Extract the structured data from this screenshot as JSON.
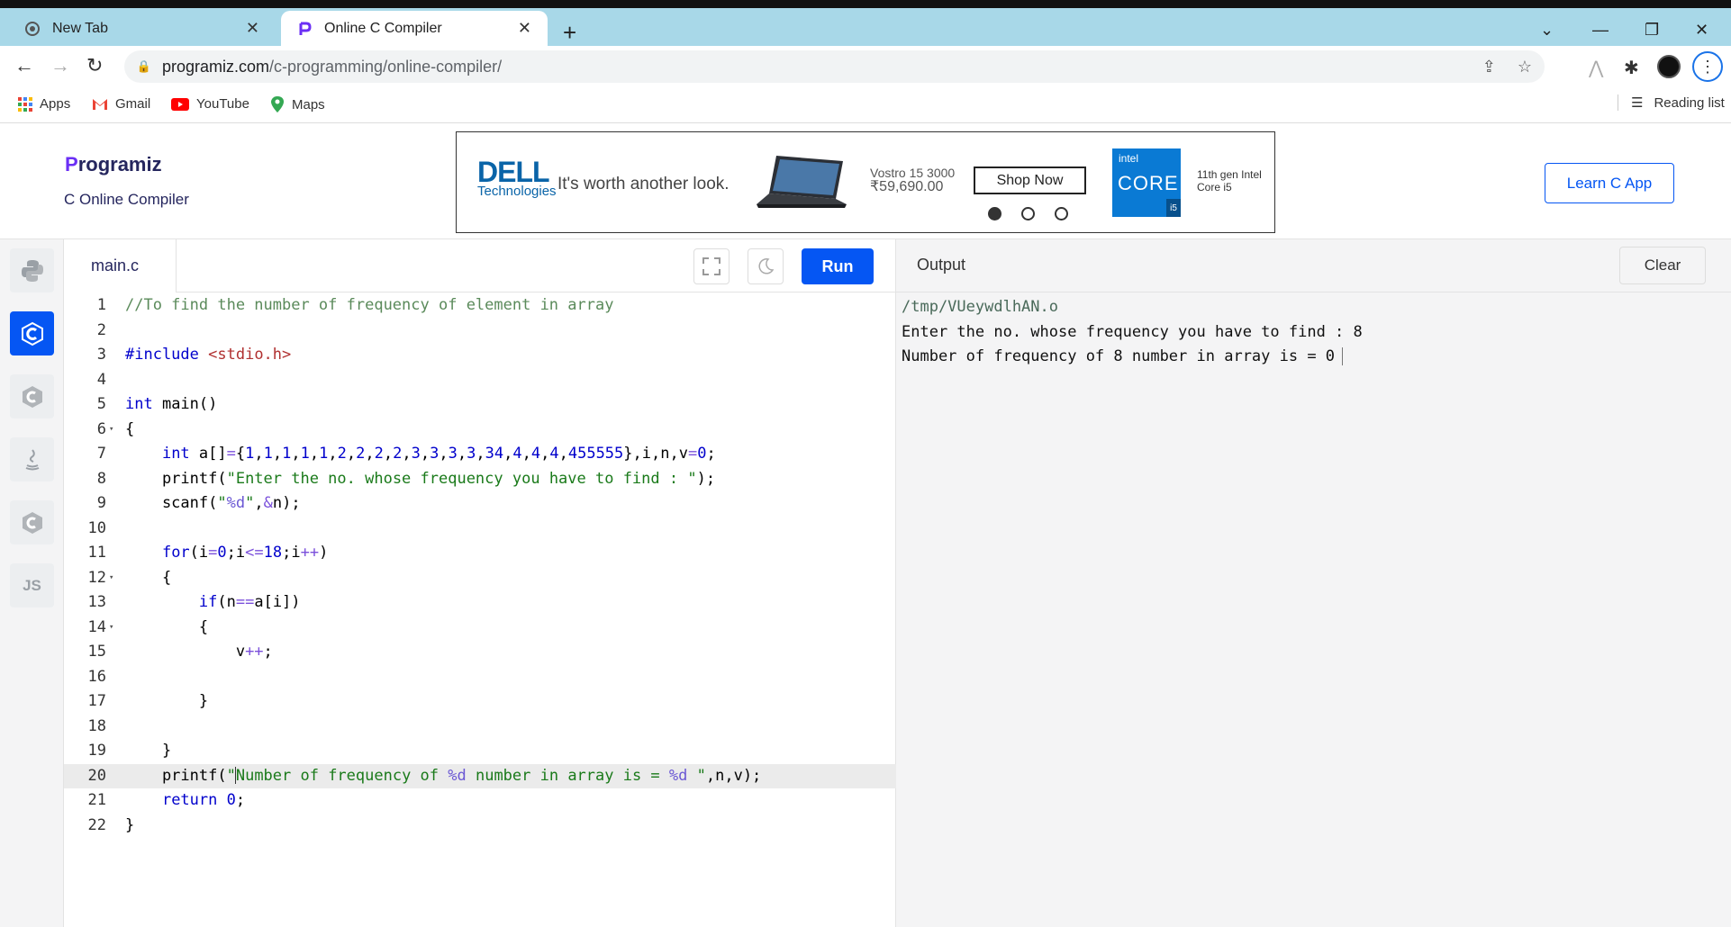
{
  "browser": {
    "tabs": [
      {
        "title": "New Tab",
        "active": false
      },
      {
        "title": "Online C Compiler",
        "active": true
      }
    ],
    "url_domain": "programiz.com",
    "url_path": "/c-programming/online-compiler/",
    "bookmarks": [
      "Apps",
      "Gmail",
      "YouTube",
      "Maps"
    ],
    "reading_list": "Reading list"
  },
  "site": {
    "logo_initial": "P",
    "logo_rest": "rogramiz",
    "subtitle": "C Online Compiler",
    "learn_button": "Learn C App"
  },
  "ad": {
    "brand": "DELL",
    "brand_sub": "Technologies",
    "tagline": "It's worth another look.",
    "model": "Vostro 15 3000",
    "price": "₹59,690.00",
    "cta": "Shop Now",
    "intel_top": "intel",
    "intel_core": "CORE",
    "intel_tier": "i5",
    "gen_line1": "11th gen Intel",
    "gen_line2": "Core i5"
  },
  "rail": {
    "items": [
      "python",
      "c",
      "cpp",
      "java",
      "csharp",
      "JS"
    ],
    "active": "c"
  },
  "editor": {
    "filename": "main.c",
    "run_label": "Run",
    "highlighted_line": 20,
    "code_lines": [
      "//To find the number of frequency of element in array",
      "",
      "#include <stdio.h>",
      "",
      "int main()",
      "{",
      "    int a[]={1,1,1,1,1,2,2,2,2,3,3,3,3,34,4,4,4,455555},i,n,v=0;",
      "    printf(\"Enter the no. whose frequency you have to find : \");",
      "    scanf(\"%d\",&n);",
      "",
      "    for(i=0;i<=18;i++)",
      "    {",
      "        if(n==a[i])",
      "        {",
      "            v++;",
      "",
      "        }",
      "",
      "    }",
      "    printf(\"Number of frequency of %d number in array is = %d \",n,v);",
      "    return 0;",
      "}"
    ]
  },
  "output": {
    "title": "Output",
    "clear_label": "Clear",
    "lines": [
      "/tmp/VUeywdlhAN.o",
      "Enter the no. whose frequency you have to find : 8",
      "Number of frequency of 8 number in array is = 0"
    ]
  },
  "colors": {
    "accent": "#0556f3",
    "tabbar": "#a8d8e8"
  }
}
